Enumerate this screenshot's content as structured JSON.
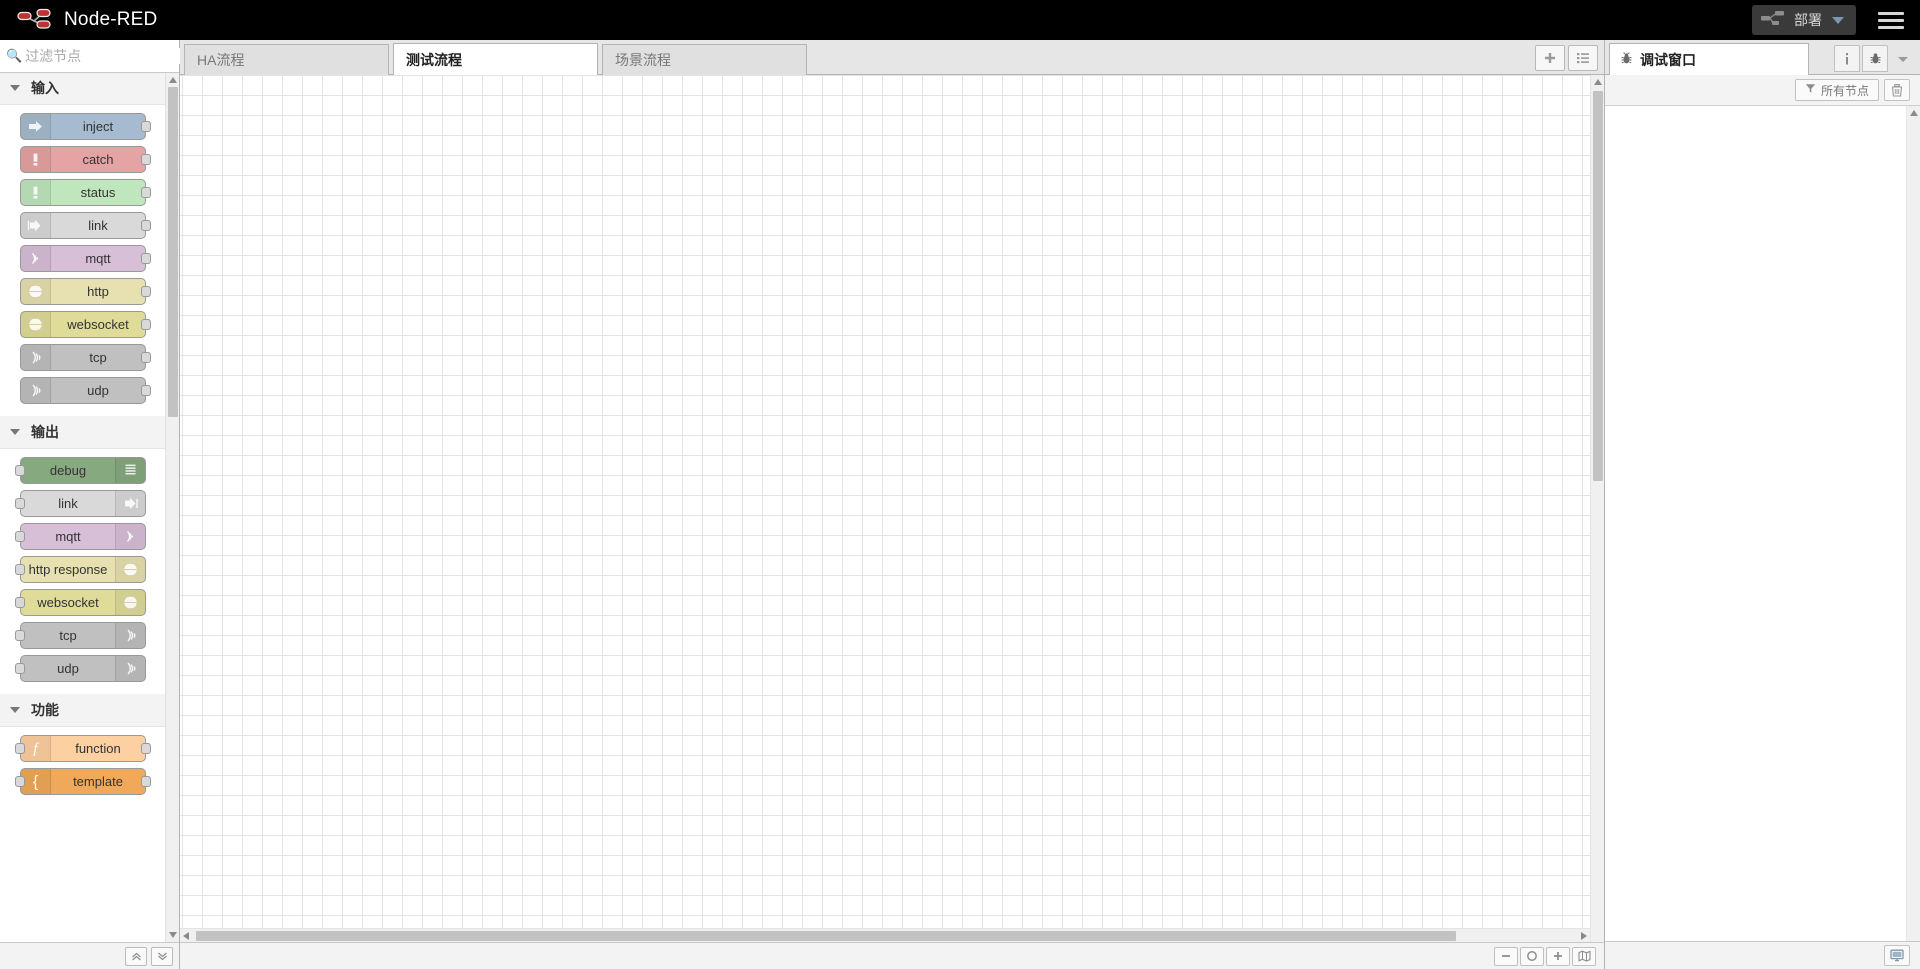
{
  "header": {
    "brand_title": "Node-RED",
    "logo_icon": "node-red-logo",
    "deploy_label": "部署",
    "deploy_caret_icon": "caret-down-icon",
    "menu_icon": "hamburger-menu-icon"
  },
  "palette": {
    "search_placeholder": "过滤节点",
    "search_value": "",
    "search_icon": "search-icon",
    "footer": {
      "collapse_all_icon": "chevron-double-up-icon",
      "expand_all_icon": "chevron-double-down-icon"
    },
    "categories": [
      {
        "label": "输入",
        "caret_icon": "chevron-down-icon",
        "nodes": [
          {
            "label": "inject",
            "color": "#a6bbcf",
            "icon": "arrow-right-icon",
            "icon_side": "left",
            "ports": [
              "out"
            ]
          },
          {
            "label": "catch",
            "color": "#e6a3a3",
            "icon": "exclamation-icon",
            "icon_side": "left",
            "ports": [
              "out"
            ]
          },
          {
            "label": "status",
            "color": "#c0e6bd",
            "icon": "exclamation-icon",
            "icon_side": "left",
            "ports": [
              "out"
            ]
          },
          {
            "label": "link",
            "color": "#d9d9d9",
            "icon": "link-out-icon",
            "icon_side": "left",
            "ports": [
              "out"
            ]
          },
          {
            "label": "mqtt",
            "color": "#d8bfd8",
            "icon": "wifi-icon",
            "icon_side": "left",
            "ports": [
              "out"
            ]
          },
          {
            "label": "http",
            "color": "#e7e0b0",
            "icon": "globe-icon",
            "icon_side": "left",
            "ports": [
              "out"
            ]
          },
          {
            "label": "websocket",
            "color": "#dfdb98",
            "icon": "globe-icon",
            "icon_side": "left",
            "ports": [
              "out"
            ]
          },
          {
            "label": "tcp",
            "color": "#c0c0c0",
            "icon": "signal-icon",
            "icon_side": "left",
            "ports": [
              "out"
            ]
          },
          {
            "label": "udp",
            "color": "#c0c0c0",
            "icon": "signal-icon",
            "icon_side": "left",
            "ports": [
              "out"
            ]
          }
        ]
      },
      {
        "label": "输出",
        "caret_icon": "chevron-down-icon",
        "nodes": [
          {
            "label": "debug",
            "color": "#87a980",
            "icon": "list-lines-icon",
            "icon_side": "right",
            "ports": [
              "in"
            ]
          },
          {
            "label": "link",
            "color": "#d9d9d9",
            "icon": "link-in-icon",
            "icon_side": "right",
            "ports": [
              "in"
            ]
          },
          {
            "label": "mqtt",
            "color": "#d8bfd8",
            "icon": "wifi-icon",
            "icon_side": "right",
            "ports": [
              "in"
            ]
          },
          {
            "label": "http response",
            "color": "#e7e0b0",
            "icon": "globe-icon",
            "icon_side": "right",
            "ports": [
              "in"
            ]
          },
          {
            "label": "websocket",
            "color": "#dfdb98",
            "icon": "globe-icon",
            "icon_side": "right",
            "ports": [
              "in"
            ]
          },
          {
            "label": "tcp",
            "color": "#c0c0c0",
            "icon": "signal-icon",
            "icon_side": "right",
            "ports": [
              "in"
            ]
          },
          {
            "label": "udp",
            "color": "#c0c0c0",
            "icon": "signal-icon",
            "icon_side": "right",
            "ports": [
              "in"
            ]
          }
        ]
      },
      {
        "label": "功能",
        "caret_icon": "chevron-down-icon",
        "nodes": [
          {
            "label": "function",
            "color": "#fdd0a2",
            "icon": "function-f-icon",
            "icon_side": "left",
            "ports": [
              "in",
              "out"
            ]
          },
          {
            "label": "template",
            "color": "#f0a95a",
            "icon": "brace-icon",
            "icon_side": "left",
            "ports": [
              "in",
              "out"
            ]
          }
        ]
      }
    ]
  },
  "workspace": {
    "tabs": [
      {
        "label": "HA流程",
        "active": false
      },
      {
        "label": "测试流程",
        "active": true
      },
      {
        "label": "场景流程",
        "active": false
      }
    ],
    "actions": {
      "add_tab_icon": "plus-icon",
      "list_tabs_icon": "list-icon"
    },
    "zoom_controls": {
      "zoom_out_icon": "minus-icon",
      "zoom_reset_icon": "circle-icon",
      "zoom_in_icon": "plus-icon",
      "navigator_icon": "map-icon"
    }
  },
  "sidebar": {
    "tab": {
      "label": "调试窗口",
      "icon": "bug-icon"
    },
    "tab_actions": {
      "info_icon": "info-icon",
      "debug_icon": "bug-icon",
      "more_icon": "caret-down-icon"
    },
    "toolbar": {
      "filter_label": "所有节点",
      "filter_icon": "funnel-icon",
      "clear_icon": "trash-icon"
    },
    "messages": [],
    "footer": {
      "monitor_icon": "monitor-icon"
    }
  }
}
